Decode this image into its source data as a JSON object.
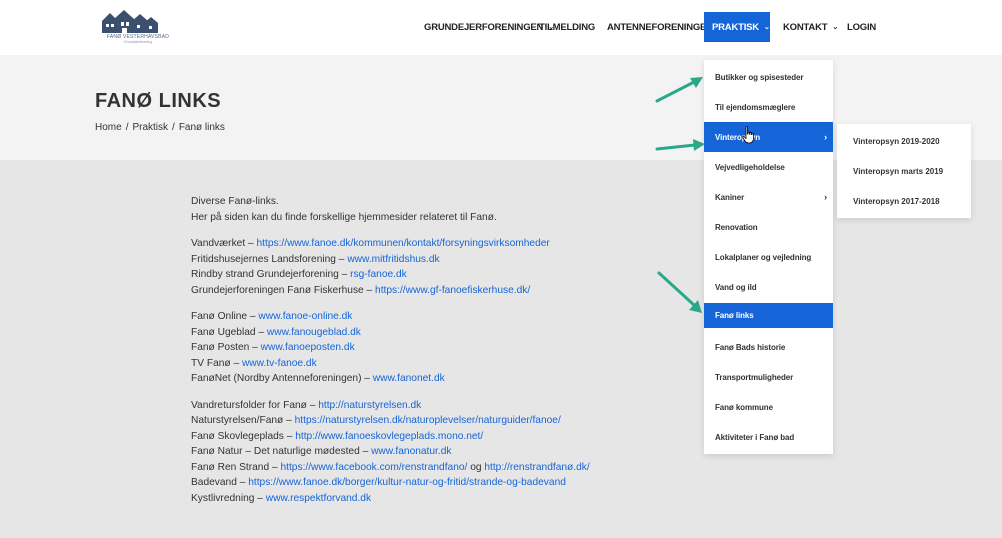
{
  "logo": {
    "name": "FANØ VESTERHAVSBAD",
    "sub": "Grundejerforening"
  },
  "nav": {
    "items": [
      {
        "label": "GRUNDEJERFORENINGEN",
        "chevron": true
      },
      {
        "label": "TILMELDING",
        "chevron": false
      },
      {
        "label": "ANTENNEFORENINGEN",
        "chevron": true
      },
      {
        "label": "PRAKTISK",
        "chevron": true
      },
      {
        "label": "KONTAKT",
        "chevron": true
      },
      {
        "label": "LOGIN",
        "chevron": false
      }
    ],
    "active": "PRAKTISK"
  },
  "page": {
    "title": "FANØ LINKS",
    "breadcrumb": [
      "Home",
      "Praktisk",
      "Fanø links"
    ],
    "breadcrumb_sep": "/"
  },
  "content": {
    "intro": [
      "Diverse Fanø-links.",
      "Her på siden kan du finde forskellige hjemmesider relateret til Fanø."
    ],
    "groups": [
      [
        {
          "text": "Vandværket – ",
          "link": "https://www.fanoe.dk/kommunen/kontakt/forsyningsvirksomheder"
        },
        {
          "text": "Fritidshusejernes Landsforening – ",
          "link": "www.mitfritidshus.dk"
        },
        {
          "text": "Rindby strand Grundejerforening – ",
          "link": "rsg-fanoe.dk"
        },
        {
          "text": "Grundejerforeningen Fanø Fiskerhuse – ",
          "link": "https://www.gf-fanoefiskerhuse.dk/"
        }
      ],
      [
        {
          "text": "Fanø Online – ",
          "link": "www.fanoe-online.dk"
        },
        {
          "text": "Fanø Ugeblad – ",
          "link": "www.fanougeblad.dk"
        },
        {
          "text": "Fanø Posten – ",
          "link": "www.fanoeposten.dk"
        },
        {
          "text": "TV Fanø – ",
          "link": "www.tv-fanoe.dk"
        },
        {
          "text": "FanøNet (Nordby Antenneforeningen) – ",
          "link": "www.fanonet.dk"
        }
      ],
      [
        {
          "text": "Vandretursfolder for Fanø – ",
          "link": "http://naturstyrelsen.dk"
        },
        {
          "text": "Naturstyrelsen/Fanø – ",
          "link": "https://naturstyrelsen.dk/naturoplevelser/naturguider/fanoe/"
        },
        {
          "text": "Fanø Skovlegeplads – ",
          "link": "http://www.fanoeskovlegeplads.mono.net/"
        },
        {
          "text": "Fanø Natur – Det naturlige mødested – ",
          "link": "www.fanonatur.dk"
        },
        {
          "text": "Fanø Ren Strand – ",
          "link": "https://www.facebook.com/renstrandfano/",
          "text2": " og ",
          "link2": "http://renstrandfanø.dk/"
        },
        {
          "text": "Badevand – ",
          "link": "https://www.fanoe.dk/borger/kultur-natur-og-fritid/strande-og-badevand"
        },
        {
          "text": "Kystlivredning – ",
          "link": "www.respektforvand.dk"
        }
      ]
    ]
  },
  "dropdown": {
    "items": [
      {
        "label": "Butikker og spisesteder",
        "has_sub": false
      },
      {
        "label": "Til ejendomsmæglere",
        "has_sub": false
      },
      {
        "label": "Vinteropsyn",
        "has_sub": true
      },
      {
        "label": "Vejvedligeholdelse",
        "has_sub": false
      },
      {
        "label": "Kaniner",
        "has_sub": true
      },
      {
        "label": "Renovation",
        "has_sub": false
      },
      {
        "label": "Lokalplaner og vejledning",
        "has_sub": false
      },
      {
        "label": "Vand og ild",
        "has_sub": false
      },
      {
        "label": "Fanø links",
        "has_sub": false
      },
      {
        "label": "Fanø Bads historie",
        "has_sub": false
      },
      {
        "label": "Transportmuligheder",
        "has_sub": false
      },
      {
        "label": "Fanø kommune",
        "has_sub": false
      },
      {
        "label": "Aktiviteter i Fanø bad",
        "has_sub": false
      }
    ],
    "hovered": "Vinteropsyn",
    "current": "Fanø links"
  },
  "submenu": {
    "items": [
      "Vinteropsyn 2019-2020",
      "Vinteropsyn marts 2019",
      "Vinteropsyn 2017-2018"
    ]
  },
  "colors": {
    "accent": "#1565d8",
    "arrow": "#2aa889",
    "title_band": "#f3f3f3",
    "content_bg": "#e6e6e6"
  },
  "icons": {
    "chevron": "chevron-down-icon",
    "submenu_arrow": "chevron-right-icon",
    "cursor": "hand-pointer-icon",
    "annotation": "green-arrow-icon"
  }
}
